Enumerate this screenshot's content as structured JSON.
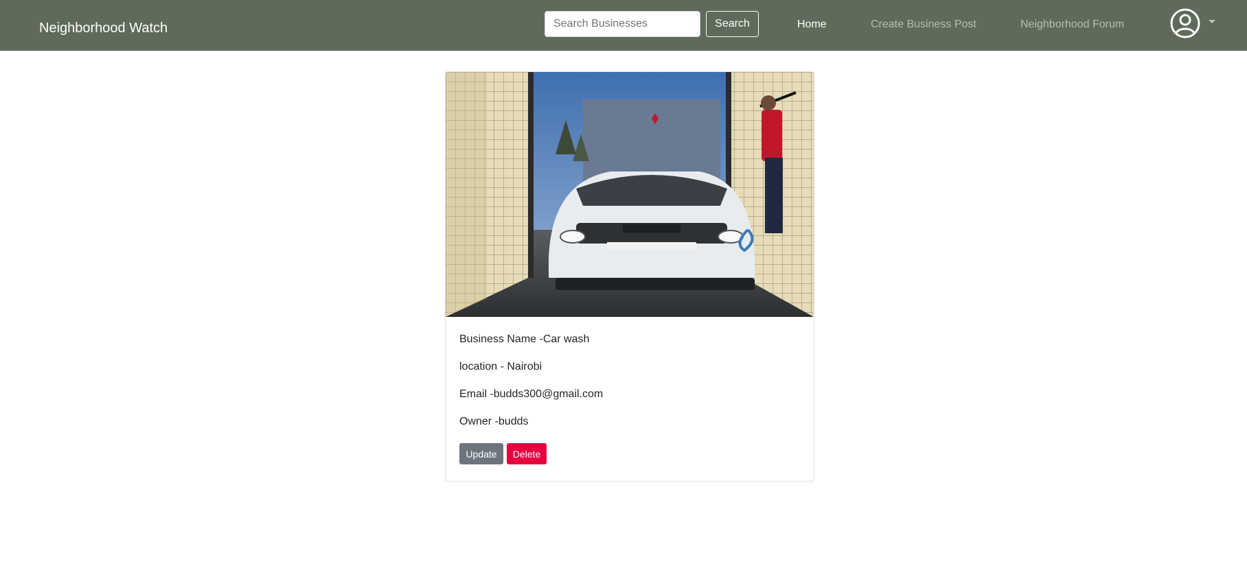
{
  "navbar": {
    "brand": "Neighborhood Watch",
    "search_placeholder": "Search Businesses",
    "search_button": "Search",
    "links": {
      "home": "Home",
      "create": "Create Business Post",
      "forum": "Neighborhood Forum"
    },
    "user_icon": "user-circle-icon"
  },
  "business": {
    "image_icon": "car-wash-photo",
    "name": "Business Name -Car wash",
    "location": "location - Nairobi",
    "email": "Email -budds300@gmail.com",
    "owner": "Owner -budds",
    "update_label": "Update",
    "delete_label": "Delete"
  },
  "colors": {
    "navbar_bg": "#5e6b5a",
    "update_btn": "#6c757d",
    "delete_btn": "#e7023f"
  }
}
